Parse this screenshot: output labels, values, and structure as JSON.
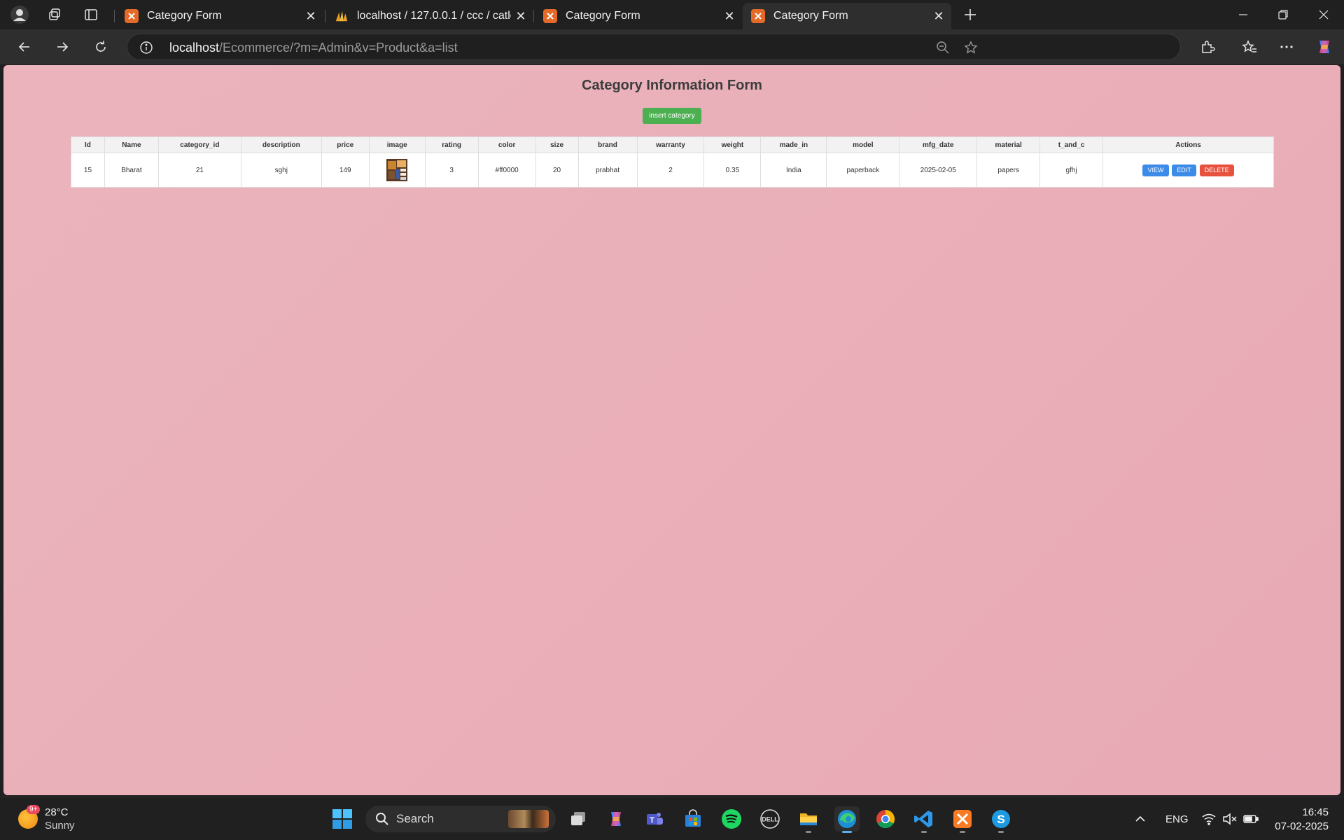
{
  "tabs": [
    {
      "title": "Category Form",
      "favicon": "xampp-icon"
    },
    {
      "title": "localhost / 127.0.0.1 / ccc / catlog",
      "favicon": "phpmyadmin-icon"
    },
    {
      "title": "Category Form",
      "favicon": "xampp-icon"
    },
    {
      "title": "Category Form",
      "favicon": "xampp-icon",
      "active": true
    }
  ],
  "address": {
    "host": "localhost",
    "path": "/Ecommerce/?m=Admin&v=Product&a=list"
  },
  "page": {
    "title": "Category Information Form",
    "insert_button": "insert category",
    "columns": [
      "Id",
      "Name",
      "category_id",
      "description",
      "price",
      "image",
      "rating",
      "color",
      "size",
      "brand",
      "warranty",
      "weight",
      "made_in",
      "model",
      "mfg_date",
      "material",
      "t_and_c",
      "Actions"
    ],
    "rows": [
      {
        "id": "15",
        "name": "Bharat",
        "category_id": "21",
        "description": "sghj",
        "price": "149",
        "image": "product-thumbnail",
        "rating": "3",
        "color": "#ff0000",
        "size": "20",
        "brand": "prabhat",
        "warranty": "2",
        "weight": "0.35",
        "made_in": "India",
        "model": "paperback",
        "mfg_date": "2025-02-05",
        "material": "papers",
        "t_and_c": "gfhj"
      }
    ],
    "actions": {
      "view": "VIEW",
      "edit": "EDIT",
      "delete": "DELETE"
    }
  },
  "taskbar": {
    "weather": {
      "badge": "9+",
      "temp": "28°C",
      "condition": "Sunny"
    },
    "search_label": "Search",
    "language": "ENG",
    "time": "16:45",
    "date": "07-02-2025"
  },
  "colors": {
    "page_bg": "#e8aab5",
    "insert": "#4caf50",
    "view": "#3d8be8",
    "delete": "#e8513d",
    "tab_active": "#2e2e2e"
  }
}
